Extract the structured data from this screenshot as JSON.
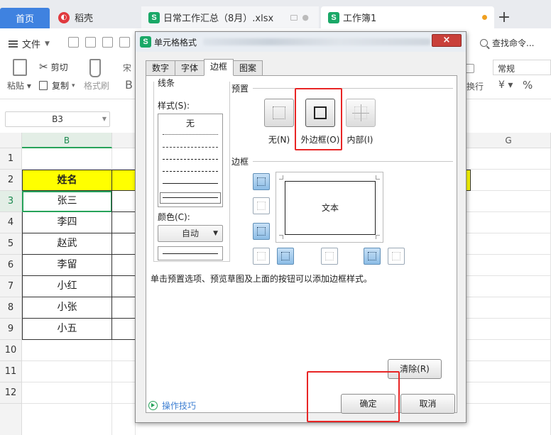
{
  "tabs": {
    "home": "首页",
    "daoke": "稻壳",
    "daily": "日常工作汇总（8月）.xlsx",
    "book": "工作簿1",
    "plus": "+"
  },
  "ribbon": {
    "file": "文件",
    "cut": "剪切",
    "copy": "复制",
    "paste": "粘贴",
    "format_painter": "格式刷",
    "font_partial": "宋",
    "bold_partial": "B",
    "search": "查找命令...",
    "number_format": "常规",
    "wrap": "换行",
    "currency": "¥",
    "percent": "%"
  },
  "formula_bar": {
    "cell_ref": "B3"
  },
  "grid": {
    "columns": [
      {
        "label": "B",
        "active": true
      },
      {
        "label": "",
        "active": false
      },
      {
        "label": "G",
        "active": false
      }
    ],
    "rows": [
      "1",
      "2",
      "3",
      "4",
      "5",
      "6",
      "7",
      "8",
      "9",
      "10",
      "11",
      "12"
    ],
    "header_cell": "姓名",
    "names": [
      "张三",
      "李四",
      "赵武",
      "李留",
      "小红",
      "小张",
      "小五"
    ]
  },
  "dialog": {
    "title": "单元格格式",
    "close": "×",
    "tabs": [
      "数字",
      "字体",
      "边框",
      "图案"
    ],
    "active_tab": "边框",
    "line_group": "线条",
    "style_label": "样式(S):",
    "style_none": "无",
    "color_label": "颜色(C):",
    "color_value": "自动",
    "preset_group": "预置",
    "presets": [
      "无(N)",
      "外边框(O)",
      "内部(I)"
    ],
    "border_group": "边框",
    "preview_text": "文本",
    "hint": "单击预置选项、预览草图及上面的按钮可以添加边框样式。",
    "clear": "清除(R)",
    "ok": "确定",
    "cancel": "取消",
    "tips": "操作技巧"
  },
  "colors": {
    "header_fill": "#ffff00",
    "selection": "#27a35a",
    "highlight": "#e82525",
    "tab_home": "#3f82e0"
  }
}
